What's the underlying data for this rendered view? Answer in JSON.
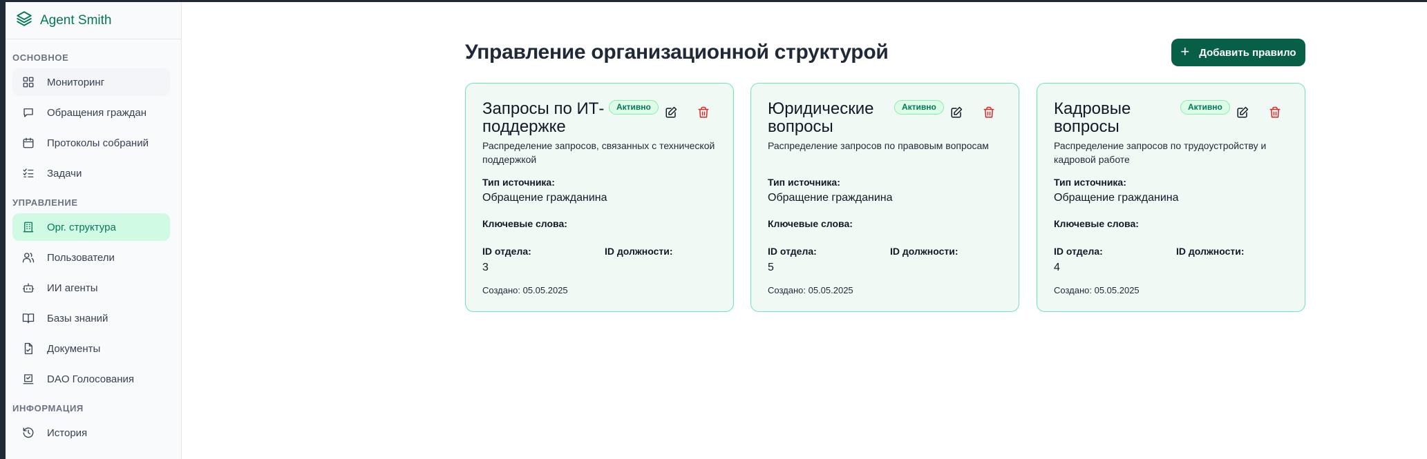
{
  "app": {
    "name": "Agent Smith"
  },
  "sidebar": {
    "sections": [
      {
        "title": "ОСНОВНОЕ",
        "items": [
          {
            "label": "Мониторинг",
            "icon": "dashboard-icon"
          },
          {
            "label": "Обращения граждан",
            "icon": "message-icon"
          },
          {
            "label": "Протоколы собраний",
            "icon": "calendar-icon"
          },
          {
            "label": "Задачи",
            "icon": "list-checks-icon"
          }
        ]
      },
      {
        "title": "УПРАВЛЕНИЕ",
        "items": [
          {
            "label": "Орг. структура",
            "icon": "building-icon",
            "active": true
          },
          {
            "label": "Пользователи",
            "icon": "users-icon"
          },
          {
            "label": "ИИ агенты",
            "icon": "bot-icon"
          },
          {
            "label": "Базы знаний",
            "icon": "book-icon"
          },
          {
            "label": "Документы",
            "icon": "file-icon"
          },
          {
            "label": "DAO Голосования",
            "icon": "vote-icon"
          }
        ]
      },
      {
        "title": "ИНФОРМАЦИЯ",
        "items": [
          {
            "label": "История",
            "icon": "history-icon"
          }
        ]
      }
    ]
  },
  "main": {
    "title": "Управление организационной структурой",
    "add_button": "Добавить правило",
    "labels": {
      "source_type": "Тип источника:",
      "keywords": "Ключевые слова:",
      "department_id": "ID отдела:",
      "position_id": "ID должности:"
    },
    "cards": [
      {
        "title": "Запросы по ИТ-поддержке",
        "status": "Активно",
        "description": "Распределение запросов, связанных с технической поддержкой",
        "source_type": "Обращение гражданина",
        "department_id": "3",
        "created": "Создано: 05.05.2025"
      },
      {
        "title": "Юридические вопросы",
        "status": "Активно",
        "description": "Распределение запросов по правовым вопросам",
        "source_type": "Обращение гражданина",
        "department_id": "5",
        "created": "Создано: 05.05.2025"
      },
      {
        "title": "Кадровые вопросы",
        "status": "Активно",
        "description": "Распределение запросов по трудоустройству и кадровой работе",
        "source_type": "Обращение гражданина",
        "department_id": "4",
        "created": "Создано: 05.05.2025"
      }
    ]
  },
  "colors": {
    "accent": "#065f46",
    "brand": "#047857",
    "card_bg": "#f0f9f4",
    "card_border": "#6ee7b7",
    "delete": "#dc2626"
  }
}
